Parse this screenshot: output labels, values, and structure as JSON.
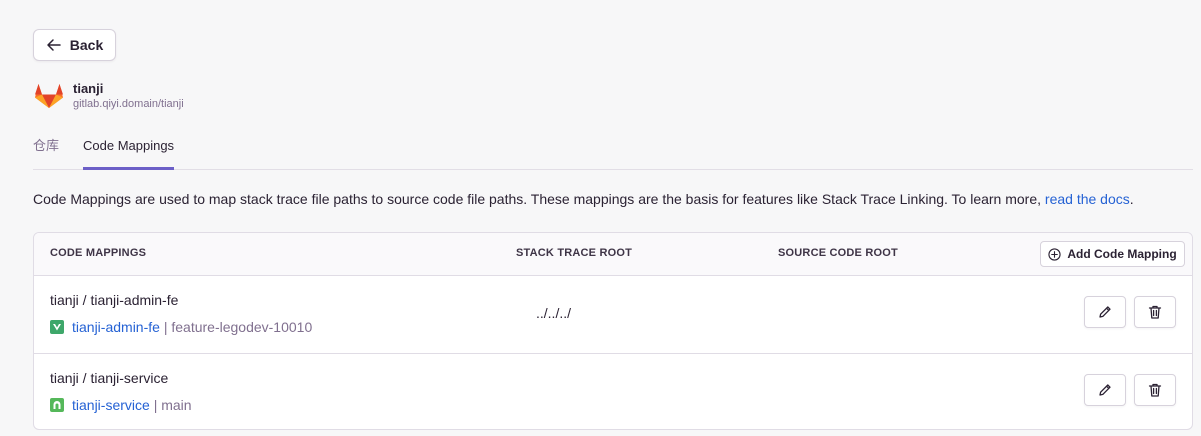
{
  "back": {
    "label": "Back"
  },
  "repo": {
    "name": "tianji",
    "url": "gitlab.qiyi.domain/tianji"
  },
  "tabs": [
    {
      "label": "仓库",
      "active": false
    },
    {
      "label": "Code Mappings",
      "active": true
    }
  ],
  "description": {
    "text": "Code Mappings are used to map stack trace file paths to source code file paths. These mappings are the basis for features like Stack Trace Linking. To learn more, ",
    "link": "read the docs"
  },
  "table": {
    "headers": {
      "code_mappings": "CODE MAPPINGS",
      "stack_trace_root": "STACK TRACE ROOT",
      "source_code_root": "SOURCE CODE ROOT"
    },
    "add_button": "Add Code Mapping",
    "rows": [
      {
        "title": "tianji / tianji-admin-fe",
        "project": "tianji-admin-fe",
        "branch": "feature-legodev-10010",
        "stack_trace_root": "../../../",
        "source_code_root": "",
        "icon_color": "#3ea76a"
      },
      {
        "title": "tianji / tianji-service",
        "project": "tianji-service",
        "branch": "main",
        "stack_trace_root": "",
        "source_code_root": "",
        "icon_color": "#55b85a"
      }
    ]
  },
  "colors": {
    "accent": "#6c5fc7",
    "link": "#2562d4",
    "muted": "#80708f"
  }
}
